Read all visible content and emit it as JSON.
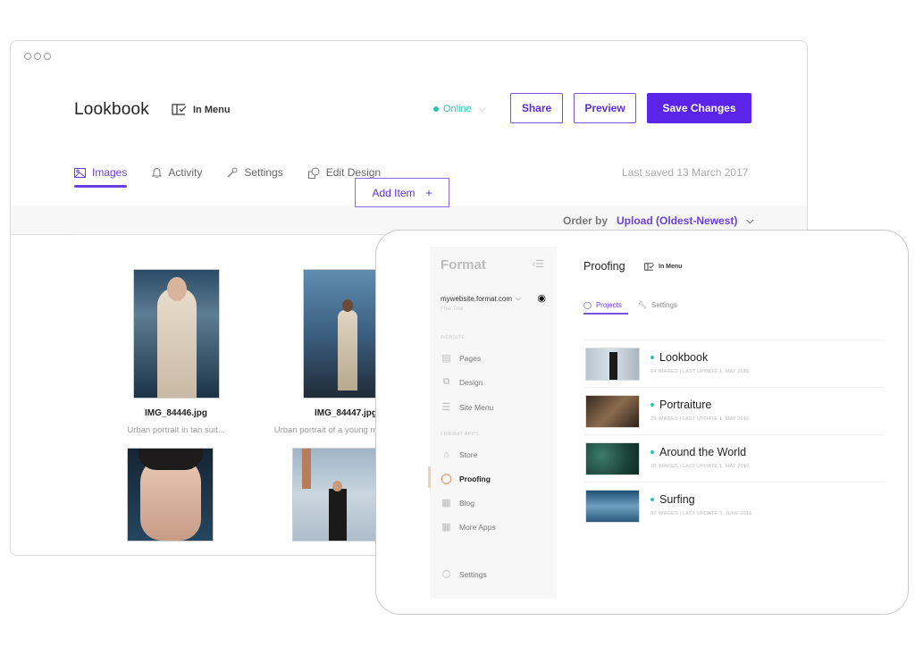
{
  "back_window": {
    "title": "Lookbook",
    "in_menu_label": "In Menu",
    "status": {
      "label": "Online",
      "color": "#2ec4b0"
    },
    "buttons": {
      "share": "Share",
      "preview": "Preview",
      "save": "Save Changes"
    },
    "accent_color": "#5b24e8",
    "tabs": [
      {
        "label": "Images",
        "icon": "image-icon",
        "active": true
      },
      {
        "label": "Activity",
        "icon": "bell-icon",
        "active": false
      },
      {
        "label": "Settings",
        "icon": "wrench-icon",
        "active": false
      },
      {
        "label": "Edit Design",
        "icon": "design-icon",
        "active": false
      }
    ],
    "last_saved": "Last saved 13 March 2017",
    "order_by": {
      "label": "Order by",
      "value": "Upload (Oldest-Newest)"
    },
    "add_item": {
      "label": "Add Item",
      "icon": "+"
    },
    "images": [
      {
        "filename": "IMG_84446.jpg",
        "description": "Urban portrait in tan suit..."
      },
      {
        "filename": "IMG_84447.jpg",
        "description": "Urban portrait of a young man walking"
      },
      {
        "filename": "",
        "description": ""
      },
      {
        "filename": "",
        "description": ""
      }
    ]
  },
  "front_window": {
    "sidebar": {
      "brand": "Format",
      "site": "mywebsite.format.com",
      "plan": "Free Trial",
      "sections": [
        {
          "label": "WEBSITE",
          "items": [
            {
              "label": "Pages",
              "icon": "pages-icon"
            },
            {
              "label": "Design",
              "icon": "design-icon"
            },
            {
              "label": "Site Menu",
              "icon": "list-icon"
            }
          ]
        },
        {
          "label": "FORMAT APPS",
          "items": [
            {
              "label": "Store",
              "icon": "bag-icon"
            },
            {
              "label": "Proofing",
              "icon": "proofing-icon",
              "active": true
            },
            {
              "label": "Blog",
              "icon": "blog-icon"
            },
            {
              "label": "More Apps",
              "icon": "grid-icon"
            }
          ]
        }
      ],
      "settings": "Settings"
    },
    "page_title": "Proofing",
    "in_menu_label": "In Menu",
    "tabs": [
      {
        "label": "Projects",
        "active": true
      },
      {
        "label": "Settings",
        "active": false
      }
    ],
    "projects": [
      {
        "name": "Lookbook",
        "meta": "64 IMAGES | LAST UPDATE 1, MAY 2016"
      },
      {
        "name": "Portraiture",
        "meta": "29 IMAGES | LAST UPDATE 1, MAY 2016"
      },
      {
        "name": "Around the World",
        "meta": "30 IMAGES | LAST UPDATE 1, MAY 2016"
      },
      {
        "name": "Surfing",
        "meta": "87 IMAGES | LAST UPDATE 3, JUNE 2016"
      }
    ]
  }
}
